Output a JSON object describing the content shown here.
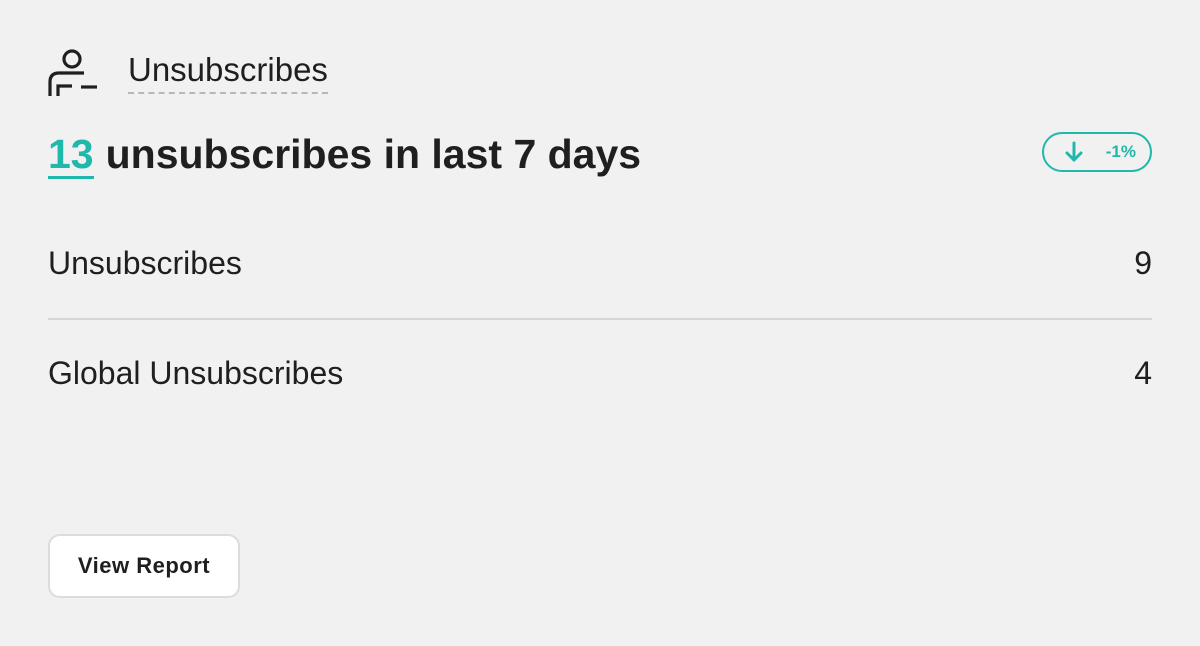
{
  "header": {
    "icon": "user-minus-icon",
    "title": "Unsubscribes"
  },
  "headline": {
    "count": "13",
    "text": "unsubscribes in last 7 days"
  },
  "trend": {
    "icon": "arrow-down-icon",
    "value": "-1%",
    "color": "#1fb8ab"
  },
  "rows": [
    {
      "label": "Unsubscribes",
      "value": "9"
    },
    {
      "label": "Global Unsubscribes",
      "value": "4"
    }
  ],
  "actions": {
    "view_report": "View Report"
  },
  "colors": {
    "accent": "#1fb8ab",
    "background": "#f1f1f1",
    "text": "#1f1f1f"
  }
}
